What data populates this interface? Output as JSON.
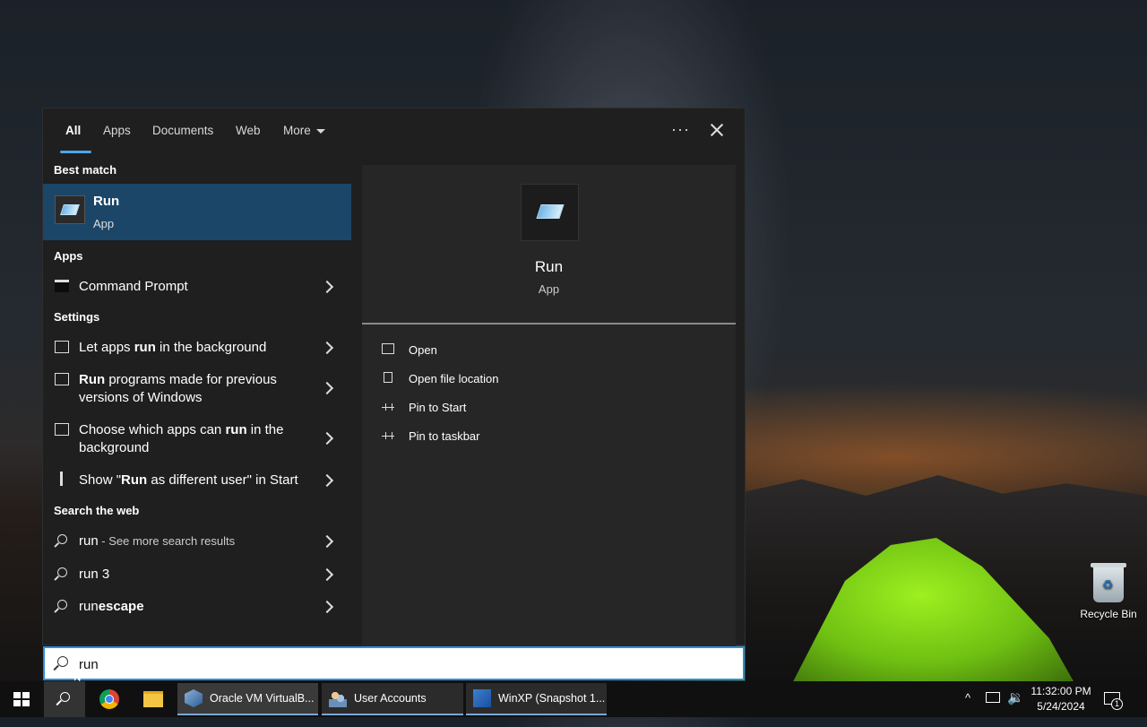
{
  "tabs": [
    "All",
    "Apps",
    "Documents",
    "Web",
    "More"
  ],
  "best_match": {
    "section": "Best match",
    "title": "Run",
    "subtitle": "App"
  },
  "apps_section": "Apps",
  "apps": [
    {
      "label": "Command Prompt"
    }
  ],
  "settings_section": "Settings",
  "settings": [
    {
      "parts": [
        "Let apps ",
        "run",
        " in the background"
      ]
    },
    {
      "parts": [
        "",
        "Run",
        " programs made for previous versions of Windows"
      ]
    },
    {
      "parts": [
        "Choose which apps can ",
        "run",
        " in the background"
      ]
    },
    {
      "parts": [
        "Show \"",
        "Run",
        " as different user\" in Start"
      ]
    }
  ],
  "web_section": "Search the web",
  "web": [
    {
      "term": "run",
      "extra": " - See more search results"
    },
    {
      "term": "run 3",
      "extra": ""
    },
    {
      "term": "runescape",
      "extra": ""
    }
  ],
  "preview": {
    "title": "Run",
    "subtitle": "App",
    "actions": [
      "Open",
      "Open file location",
      "Pin to Start",
      "Pin to taskbar"
    ]
  },
  "search": {
    "value": "run"
  },
  "desktop": {
    "recycle_bin": "Recycle Bin"
  },
  "taskbar": {
    "windows": [
      "Oracle VM VirtualB...",
      "User Accounts",
      "WinXP (Snapshot 1..."
    ],
    "time": "11:32:00 PM",
    "date": "5/24/2024",
    "notifications": "1"
  },
  "colors": {
    "accent": "#4ca6e8",
    "selected": "#1c4668",
    "search_border": "#2b8ee0"
  }
}
